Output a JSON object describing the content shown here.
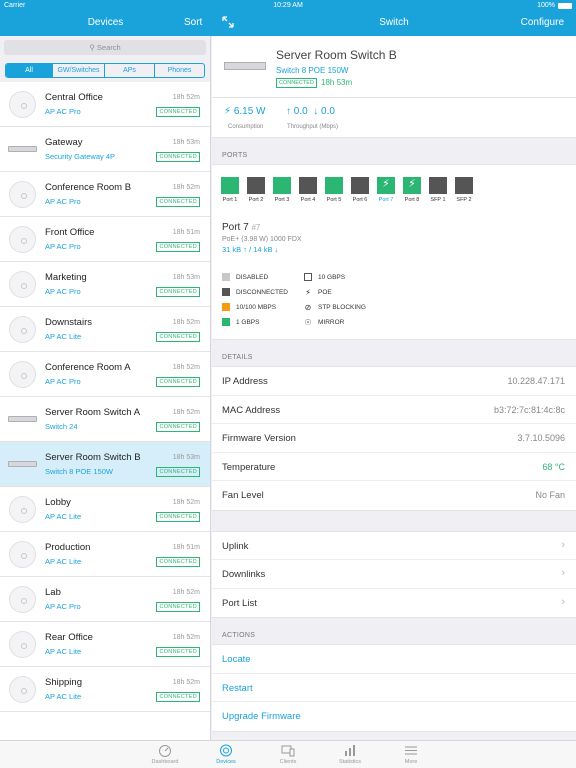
{
  "status_bar": {
    "carrier": "Carrier",
    "time": "10:29 AM",
    "battery": "100%"
  },
  "left_header": {
    "title": "Devices",
    "sort_label": "Sort"
  },
  "right_header": {
    "title": "Switch",
    "configure_label": "Configure"
  },
  "search": {
    "placeholder": "Search"
  },
  "filters": [
    "All",
    "GW/Switches",
    "APs",
    "Phones"
  ],
  "devices": [
    {
      "name": "Central Office",
      "model": "AP AC Pro",
      "time": "18h 52m",
      "status": "CONNECTED",
      "kind": "ap"
    },
    {
      "name": "Gateway",
      "model": "Security Gateway 4P",
      "time": "18h 53m",
      "status": "CONNECTED",
      "kind": "switch"
    },
    {
      "name": "Conference Room B",
      "model": "AP AC Pro",
      "time": "18h 52m",
      "status": "CONNECTED",
      "kind": "ap"
    },
    {
      "name": "Front Office",
      "model": "AP AC Pro",
      "time": "18h 51m",
      "status": "CONNECTED",
      "kind": "ap"
    },
    {
      "name": "Marketing",
      "model": "AP AC Pro",
      "time": "18h 53m",
      "status": "CONNECTED",
      "kind": "ap"
    },
    {
      "name": "Downstairs",
      "model": "AP AC Lite",
      "time": "18h 52m",
      "status": "CONNECTED",
      "kind": "ap"
    },
    {
      "name": "Conference Room A",
      "model": "AP AC Pro",
      "time": "18h 52m",
      "status": "CONNECTED",
      "kind": "ap"
    },
    {
      "name": "Server Room Switch A",
      "model": "Switch 24",
      "time": "18h 52m",
      "status": "CONNECTED",
      "kind": "switch"
    },
    {
      "name": "Server Room Switch B",
      "model": "Switch 8 POE 150W",
      "time": "18h 53m",
      "status": "CONNECTED",
      "kind": "switch",
      "selected": true
    },
    {
      "name": "Lobby",
      "model": "AP AC Lite",
      "time": "18h 52m",
      "status": "CONNECTED",
      "kind": "ap"
    },
    {
      "name": "Production",
      "model": "AP AC Lite",
      "time": "18h 51m",
      "status": "CONNECTED",
      "kind": "ap"
    },
    {
      "name": "Lab",
      "model": "AP AC Pro",
      "time": "18h 52m",
      "status": "CONNECTED",
      "kind": "ap"
    },
    {
      "name": "Rear Office",
      "model": "AP AC Lite",
      "time": "18h 52m",
      "status": "CONNECTED",
      "kind": "ap"
    },
    {
      "name": "Shipping",
      "model": "AP AC Lite",
      "time": "18h 52m",
      "status": "CONNECTED",
      "kind": "ap"
    }
  ],
  "detail": {
    "name": "Server Room Switch B",
    "model": "Switch 8 POE 150W",
    "status": "CONNECTED",
    "uptime": "18h 53m",
    "consumption_value": "6.15 W",
    "consumption_label": "Consumption",
    "throughput_up": "0.0",
    "throughput_down": "0.0",
    "throughput_label": "Throughput (Mbps)"
  },
  "sections": {
    "ports": "PORTS",
    "details": "DETAILS",
    "actions": "ACTIONS"
  },
  "ports": [
    {
      "label": "Port 1",
      "state": "1gbps"
    },
    {
      "label": "Port 2",
      "state": "disconnected"
    },
    {
      "label": "Port 3",
      "state": "1gbps"
    },
    {
      "label": "Port 4",
      "state": "disconnected"
    },
    {
      "label": "Port 5",
      "state": "1gbps"
    },
    {
      "label": "Port 6",
      "state": "disconnected"
    },
    {
      "label": "Port 7",
      "state": "poe",
      "selected": true
    },
    {
      "label": "Port 8",
      "state": "poe"
    },
    {
      "label": "SFP 1",
      "state": "disconnected"
    },
    {
      "label": "SFP 2",
      "state": "disconnected"
    }
  ],
  "port_detail": {
    "title": "Port 7",
    "index": "#7",
    "sub": "PoE+ (3.98 W)   1000 FDX",
    "rate": "31 kB ↑ / 14 kB ↓"
  },
  "legend": {
    "disabled": "DISABLED",
    "disconnected": "DISCONNECTED",
    "mbps": "10/100 MBPS",
    "gbps1": "1 GBPS",
    "gbps10": "10 GBPS",
    "poe": "POE",
    "stp": "STP BLOCKING",
    "mirror": "MIRROR"
  },
  "details": [
    {
      "key": "IP Address",
      "value": "10.228.47.171"
    },
    {
      "key": "MAC Address",
      "value": "b3:72:7c:81:4c:8c"
    },
    {
      "key": "Firmware Version",
      "value": "3.7.10.5096"
    },
    {
      "key": "Temperature",
      "value": "68 °C"
    },
    {
      "key": "Fan Level",
      "value": "No Fan"
    }
  ],
  "nav_links": [
    "Uplink",
    "Downlinks",
    "Port List"
  ],
  "actions": [
    "Locate",
    "Restart",
    "Upgrade Firmware"
  ],
  "tabs": [
    "Dashboard",
    "Devices",
    "Clients",
    "Statistics",
    "More"
  ],
  "colors": {
    "accent": "#1aa3da",
    "green": "#2bb673",
    "orange": "#f39c12"
  }
}
